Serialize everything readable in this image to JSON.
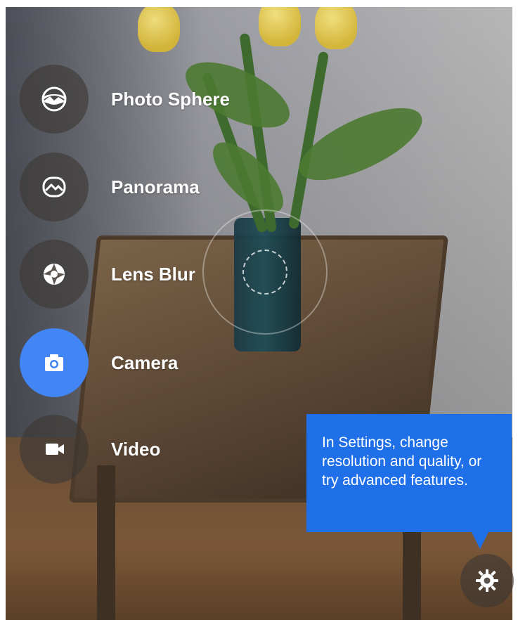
{
  "modes": [
    {
      "label": "Photo Sphere",
      "icon": "photo-sphere-icon",
      "active": false
    },
    {
      "label": "Panorama",
      "icon": "panorama-icon",
      "active": false
    },
    {
      "label": "Lens Blur",
      "icon": "lens-blur-icon",
      "active": false
    },
    {
      "label": "Camera",
      "icon": "camera-icon",
      "active": true
    },
    {
      "label": "Video",
      "icon": "video-icon",
      "active": false
    }
  ],
  "tooltip": {
    "text": "In Settings, change resolution and quality, or try advanced features."
  },
  "settings": {
    "icon": "gear-icon"
  },
  "colors": {
    "accent": "#4285f4",
    "tooltip": "#1f6fe9"
  }
}
